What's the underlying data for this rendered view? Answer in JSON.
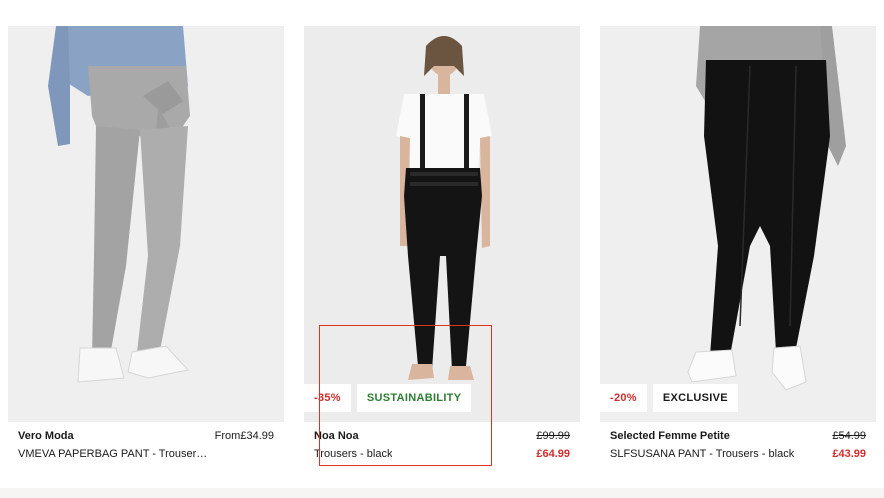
{
  "products": [
    {
      "brand": "Vero Moda",
      "name": "VMEVA PAPERBAG PANT - Trouser…",
      "price_prefix": "From",
      "price": "£34.99",
      "badges": []
    },
    {
      "brand": "Noa Noa",
      "name": "Trousers - black",
      "original_price": "£99.99",
      "sale_price": "£64.99",
      "badges": [
        "-35%",
        "SUSTAINABILITY"
      ]
    },
    {
      "brand": "Selected Femme Petite",
      "name": "SLFSUSANA PANT - Trousers - black",
      "original_price": "£54.99",
      "sale_price": "£43.99",
      "badges": [
        "-20%",
        "EXCLUSIVE"
      ]
    }
  ],
  "colors": {
    "sale_red": "#d12c2c",
    "sustainability_green": "#2e7d32",
    "highlight_box": "#e0321c"
  }
}
